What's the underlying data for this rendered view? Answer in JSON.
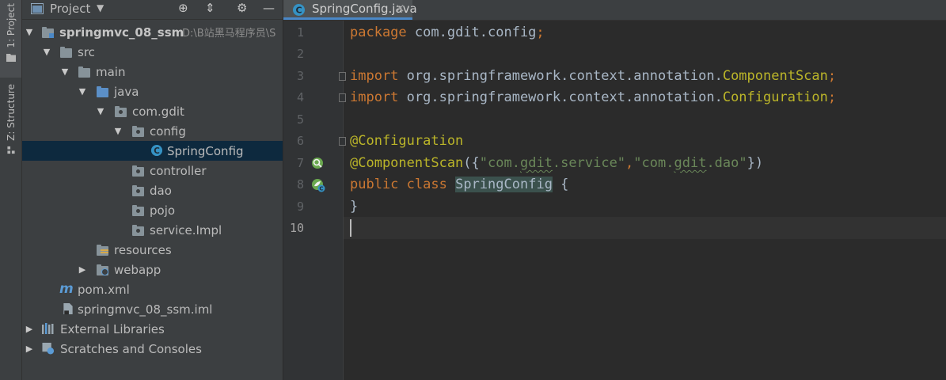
{
  "tool_strip": {
    "project_tab": "1: Project",
    "structure_tab": "Z: Structure"
  },
  "project_panel": {
    "title": "Project",
    "tree": [
      {
        "label": "springmvc_08_ssm",
        "path": "D:\\B站黑马程序员\\S",
        "icon": "module-folder-icon"
      },
      {
        "label": "src",
        "icon": "folder-icon"
      },
      {
        "label": "main",
        "icon": "folder-icon"
      },
      {
        "label": "java",
        "icon": "source-folder-icon"
      },
      {
        "label": "com.gdit",
        "icon": "package-icon"
      },
      {
        "label": "config",
        "icon": "package-icon"
      },
      {
        "label": "SpringConfig",
        "icon": "java-class-icon"
      },
      {
        "label": "controller",
        "icon": "package-icon"
      },
      {
        "label": "dao",
        "icon": "package-icon"
      },
      {
        "label": "pojo",
        "icon": "package-icon"
      },
      {
        "label": "service.Impl",
        "icon": "package-icon"
      },
      {
        "label": "resources",
        "icon": "resources-folder-icon"
      },
      {
        "label": "webapp",
        "icon": "web-folder-icon"
      },
      {
        "label": "pom.xml",
        "icon": "maven-icon"
      },
      {
        "label": "springmvc_08_ssm.iml",
        "icon": "iml-file-icon"
      },
      {
        "label": "External Libraries",
        "icon": "libraries-icon"
      },
      {
        "label": "Scratches and Consoles",
        "icon": "scratches-icon"
      }
    ]
  },
  "editor": {
    "tab_label": "SpringConfig.java",
    "tab_close": "×",
    "line_numbers": [
      "1",
      "2",
      "3",
      "4",
      "5",
      "6",
      "7",
      "8",
      "9",
      "10"
    ],
    "code": {
      "l1_kw": "package",
      "l1_rest": " com.gdit.config",
      "l1_semi": ";",
      "l3_kw": "import",
      "l3_pkg": " org.springframework.context.annotation.",
      "l3_cls": "ComponentScan",
      "l3_semi": ";",
      "l4_kw": "import",
      "l4_pkg": " org.springframework.context.annotation.",
      "l4_cls": "Configuration",
      "l4_semi": ";",
      "l6_ann": "@Configuration",
      "l7_ann": "@ComponentScan",
      "l7_open": "({",
      "l7_s1a": "\"com.",
      "l7_s1b": "gdit",
      "l7_s1c": ".service\"",
      "l7_comma": ",",
      "l7_s2a": "\"com.",
      "l7_s2b": "gdit",
      "l7_s2c": ".dao\"",
      "l7_close": "})",
      "l8_kw1": "public",
      "l8_kw2": "class",
      "l8_name": "SpringConfig",
      "l8_brace": " {",
      "l9_brace": "}"
    }
  }
}
